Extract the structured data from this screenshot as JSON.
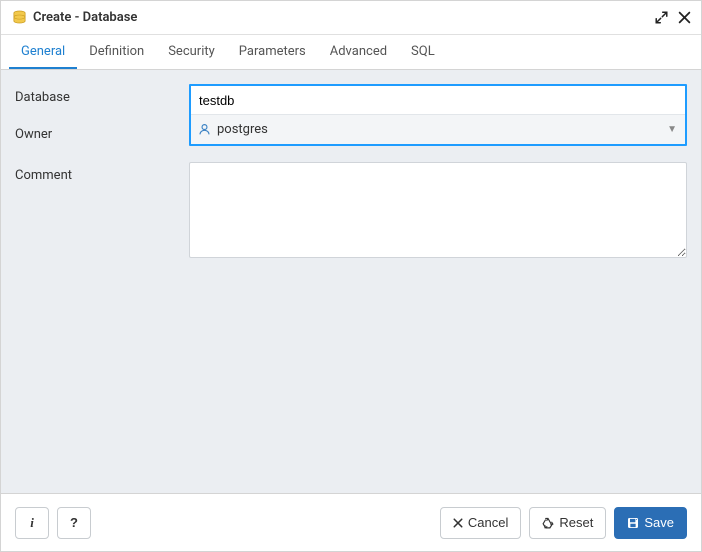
{
  "title": "Create - Database",
  "tabs": {
    "general": "General",
    "definition": "Definition",
    "security": "Security",
    "parameters": "Parameters",
    "advanced": "Advanced",
    "sql": "SQL"
  },
  "labels": {
    "database": "Database",
    "owner": "Owner",
    "comment": "Comment"
  },
  "values": {
    "database": "testdb",
    "owner": "postgres",
    "comment": ""
  },
  "footer": {
    "info": "i",
    "help": "?",
    "cancel": "Cancel",
    "reset": "Reset",
    "save": "Save"
  }
}
